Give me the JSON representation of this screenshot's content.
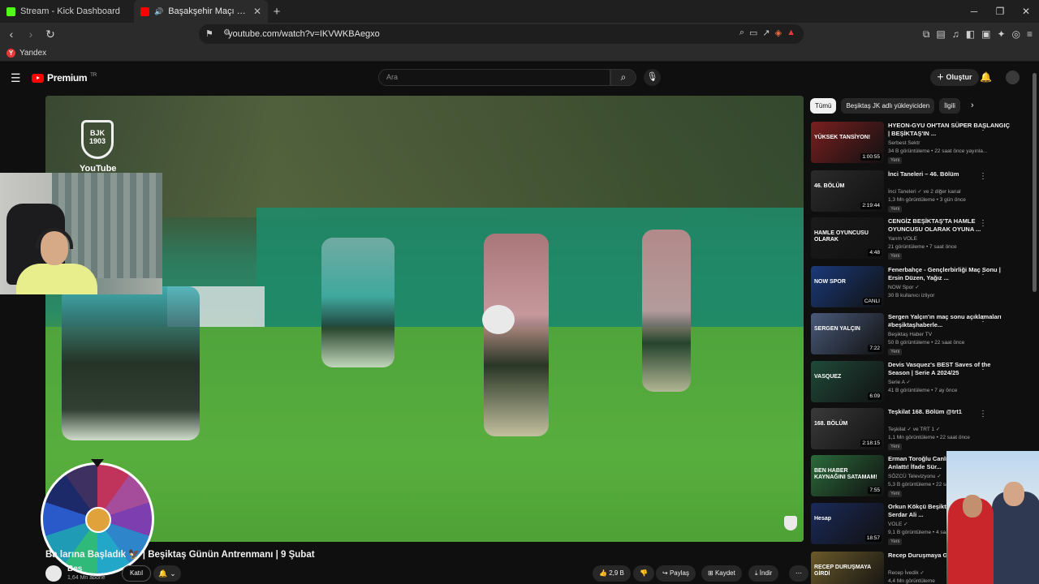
{
  "browser": {
    "tabs": [
      {
        "title": "Stream - Kick Dashboard",
        "favicon_color": "#53fc18",
        "active": false
      },
      {
        "title": "Başakşehir Maçı Hazırlıklarına...",
        "favicon_color": "#ff0000",
        "active": true
      }
    ],
    "new_tab": "+",
    "url": "youtube.com/watch?v=IKVWKBAegxo",
    "bookmark": "Yandex"
  },
  "youtube": {
    "logo_text": "Premium",
    "logo_region": "TR",
    "search_placeholder": "Ara",
    "create_label": "Oluştur",
    "chips": [
      "Tümü",
      "Beşiktaş JK adlı yükleyiciden",
      "İlgili"
    ],
    "watermark_text": "YouTube",
    "club_logo": "BJK 1903"
  },
  "video": {
    "title": "Başakşehir Maçı Hazırlıklarına Başladık 🦅 | Beşiktaş Günün Antrenmanı | 9 Şubat",
    "title_visible": "Ba                      larına Başladık 🦅 | Beşiktaş Günün Antrenmanı | 9 Şubat",
    "channel": "Beş",
    "subs": "1,64 Mn abone",
    "join_label": "Katıl",
    "likes": "2,9 B",
    "share_label": "Paylaş",
    "save_label": "Kaydet",
    "download_label": "İndir"
  },
  "recommendations": [
    {
      "title": "HYEON-GYU OH'TAN SÜPER BAŞLANGIÇ | BEŞİKTAŞ'IN ...",
      "channel": "Serbest Sektr",
      "meta": "34 B görüntüleme • 22 saat önce yayınla...",
      "badge": "Yeni",
      "duration": "1:00:55",
      "thumb_color": "#7a1f1f",
      "thumb_text": "YÜKSEK TANSİYON!"
    },
    {
      "title": "İnci Taneleri – 46. Bölüm",
      "channel": "İnci Taneleri ✓ ve 2 diğer kanal",
      "meta": "1,3 Mn görüntüleme • 3 gün önce",
      "badge": "Yeni",
      "duration": "2:19:44",
      "thumb_color": "#2b2b2b",
      "thumb_text": "46. BÖLÜM"
    },
    {
      "title": "CENGİZ BEŞİKTAŞ'TA HAMLE OYUNCUSU OLARAK OYUNA ...",
      "channel": "Yarım VOLE",
      "meta": "21 görüntüleme • 7 saat önce",
      "badge": "Yeni",
      "duration": "4:48",
      "thumb_color": "#1a1a1a",
      "thumb_text": "HAMLE OYUNCUSU OLARAK"
    },
    {
      "title": "Fenerbahçe - Gençlerbirliği Maç Sonu | Ersin Düzen, Yağız ...",
      "channel": "NOW Spor ✓",
      "meta": "30 B kullanıcı izliyor",
      "badge": "",
      "duration": "CANLI",
      "thumb_color": "#1a3a7a",
      "thumb_text": "NOW SPOR"
    },
    {
      "title": "Sergen Yalçın'ın maç sonu açıklamaları #beşiktaşhaberle...",
      "channel": "Beşiktaş Haber TV",
      "meta": "50 B görüntüleme • 22 saat önce",
      "badge": "Yeni",
      "duration": "7:22",
      "thumb_color": "#4a5a7a",
      "thumb_text": "SERGEN YALÇIN"
    },
    {
      "title": "Devis Vasquez's BEST Saves of the Season | Serie A 2024/25",
      "channel": "Serie A ✓",
      "meta": "41 B görüntüleme • 7 ay önce",
      "badge": "",
      "duration": "6:09",
      "thumb_color": "#1f4a3a",
      "thumb_text": "VASQUEZ"
    },
    {
      "title": "Teşkilat 168. Bölüm @trt1",
      "channel": "Teşkilat ✓ ve TRT 1 ✓",
      "meta": "1,1 Mn görüntüleme • 22 saat önce",
      "badge": "Yeni",
      "duration": "2:18:15",
      "thumb_color": "#3a3a3a",
      "thumb_text": "168. BÖLÜM"
    },
    {
      "title": "Erman Toroğlu Canlı Yayında Bir Kez Anlattı! İfade Sür...",
      "channel": "SÖZCÜ Televizyonu ✓",
      "meta": "5,3 B görüntüleme • 22 saat önce",
      "badge": "Yeni",
      "duration": "7:55",
      "thumb_color": "#2a6a3a",
      "thumb_text": "BEN HABER KAYNAĞINI SATAMAM!"
    },
    {
      "title": "Orkun Kökçü Beşiktaş'ta geçecektir | Serdar Ali ...",
      "channel": "VOLE ✓",
      "meta": "9,1 B görüntüleme • 4 saat önce",
      "badge": "Yeni",
      "duration": "18:57",
      "thumb_color": "#1a2a5a",
      "thumb_text": "Hesap"
    },
    {
      "title": "Recep Duruşmaya Girdi | İvedik 7",
      "channel": "Recep İvedik ✓",
      "meta": "4,4 Mn görüntüleme",
      "badge": "",
      "duration": "",
      "thumb_color": "#6a5a2a",
      "thumb_text": "RECEP DURUŞMAYA GİRDİ"
    }
  ]
}
